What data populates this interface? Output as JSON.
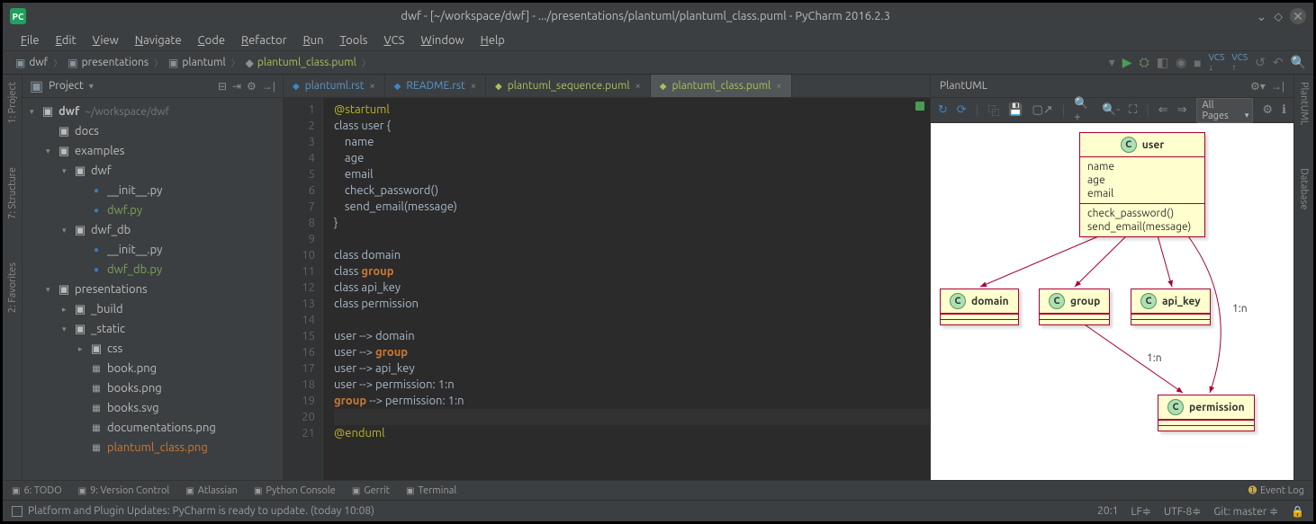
{
  "title": "dwf - [~/workspace/dwf] - .../presentations/plantuml/plantuml_class.puml - PyCharm 2016.2.3",
  "menu": [
    "File",
    "Edit",
    "View",
    "Navigate",
    "Code",
    "Refactor",
    "Run",
    "Tools",
    "VCS",
    "Window",
    "Help"
  ],
  "breadcrumbs": [
    {
      "icon": "folder",
      "label": "dwf"
    },
    {
      "icon": "folder",
      "label": "presentations"
    },
    {
      "icon": "folder",
      "label": "plantuml"
    },
    {
      "icon": "file",
      "label": "plantuml_class.puml",
      "cls": "puml"
    }
  ],
  "left_tabs": [
    "1: Project",
    "7: Structure",
    "2: Favorites"
  ],
  "right_tabs": [
    "PlantUML",
    "Database"
  ],
  "project": {
    "header": "Project",
    "tree": [
      {
        "depth": 0,
        "arrow": "▾",
        "icon": "folder",
        "label": "dwf",
        "bold": true,
        "hint": "~/workspace/dwf"
      },
      {
        "depth": 1,
        "arrow": "",
        "icon": "folder",
        "label": "docs"
      },
      {
        "depth": 1,
        "arrow": "▾",
        "icon": "folder",
        "label": "examples"
      },
      {
        "depth": 2,
        "arrow": "▾",
        "icon": "folder",
        "label": "dwf"
      },
      {
        "depth": 3,
        "arrow": "",
        "icon": "py",
        "label": "__init__.py"
      },
      {
        "depth": 3,
        "arrow": "",
        "icon": "py",
        "label": "dwf.py",
        "cls": "py-fg"
      },
      {
        "depth": 2,
        "arrow": "▾",
        "icon": "folder",
        "label": "dwf_db"
      },
      {
        "depth": 3,
        "arrow": "",
        "icon": "py",
        "label": "__init__.py"
      },
      {
        "depth": 3,
        "arrow": "",
        "icon": "py",
        "label": "dwf_db.py",
        "cls": "py-fg"
      },
      {
        "depth": 1,
        "arrow": "▾",
        "icon": "folder",
        "label": "presentations"
      },
      {
        "depth": 2,
        "arrow": "▸",
        "icon": "folder",
        "label": "_build"
      },
      {
        "depth": 2,
        "arrow": "▾",
        "icon": "folder",
        "label": "_static"
      },
      {
        "depth": 3,
        "arrow": "▸",
        "icon": "folder",
        "label": "css"
      },
      {
        "depth": 3,
        "arrow": "",
        "icon": "img",
        "label": "book.png"
      },
      {
        "depth": 3,
        "arrow": "",
        "icon": "img",
        "label": "books.png"
      },
      {
        "depth": 3,
        "arrow": "",
        "icon": "img",
        "label": "books.svg"
      },
      {
        "depth": 3,
        "arrow": "",
        "icon": "img",
        "label": "documentations.png"
      },
      {
        "depth": 3,
        "arrow": "",
        "icon": "img",
        "label": "plantuml_class.png",
        "cls": "orange"
      }
    ]
  },
  "tabs": [
    {
      "label": "plantuml.rst",
      "type": "rst"
    },
    {
      "label": "README.rst",
      "type": "rst"
    },
    {
      "label": "plantuml_sequence.puml",
      "type": "puml"
    },
    {
      "label": "plantuml_class.puml",
      "type": "puml",
      "active": true
    }
  ],
  "code": {
    "lines": [
      {
        "n": 1,
        "t": "@startuml",
        "c": "at"
      },
      {
        "n": 2,
        "t": "class user {"
      },
      {
        "n": 3,
        "t": "    name"
      },
      {
        "n": 4,
        "t": "    age"
      },
      {
        "n": 5,
        "t": "    email"
      },
      {
        "n": 6,
        "t": "    check_password()"
      },
      {
        "n": 7,
        "t": "    send_email(message)"
      },
      {
        "n": 8,
        "t": "}"
      },
      {
        "n": 9,
        "t": ""
      },
      {
        "n": 10,
        "t": "class domain"
      },
      {
        "n": 11,
        "t": "class group",
        "hl": "group"
      },
      {
        "n": 12,
        "t": "class api_key"
      },
      {
        "n": 13,
        "t": "class permission"
      },
      {
        "n": 14,
        "t": ""
      },
      {
        "n": 15,
        "t": "user --> domain"
      },
      {
        "n": 16,
        "t": "user --> group",
        "hl": "group"
      },
      {
        "n": 17,
        "t": "user --> api_key"
      },
      {
        "n": 18,
        "t": "user --> permission: 1:n"
      },
      {
        "n": 19,
        "t": "group --> permission: 1:n",
        "hl": "group"
      },
      {
        "n": 20,
        "t": "",
        "caret": true
      },
      {
        "n": 21,
        "t": "@enduml",
        "c": "at"
      }
    ]
  },
  "plantuml": {
    "title": "PlantUML",
    "pages_dd": "All Pages",
    "user": {
      "name": "user",
      "attrs": [
        "name",
        "age",
        "email"
      ],
      "ops": [
        "check_password()",
        "send_email(message)"
      ]
    },
    "classes": [
      "domain",
      "group",
      "api_key",
      "permission"
    ],
    "labels": {
      "user_perm": "1:n",
      "group_perm": "1:n"
    }
  },
  "bottom_tools": [
    "6: TODO",
    "9: Version Control",
    "Atlassian",
    "Python Console",
    "Gerrit",
    "Terminal"
  ],
  "event_log": "Event Log",
  "status": {
    "msg": "Platform and Plugin Updates: PyCharm is ready to update. (today 10:08)",
    "pos": "20:1",
    "lf": "LF≑",
    "enc": "UTF-8≑",
    "git": "Git: master ≑",
    "lock": "🔒"
  }
}
